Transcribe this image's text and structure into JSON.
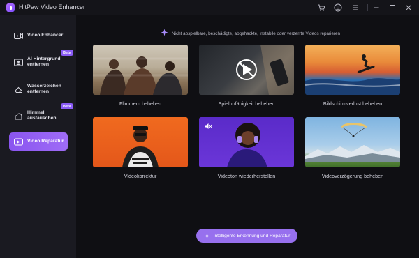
{
  "app": {
    "title": "HitPaw Video Enhancer"
  },
  "sidebar": {
    "items": [
      {
        "label": "Video Enhancer",
        "icon": "video-enhance-icon",
        "active": false,
        "beta": false
      },
      {
        "label": "AI Hintergrund entfernen",
        "icon": "background-remove-icon",
        "active": false,
        "beta": true
      },
      {
        "label": "Wasserzeichen entfernen",
        "icon": "eraser-icon",
        "active": false,
        "beta": false
      },
      {
        "label": "Himmel austauschen",
        "icon": "sky-icon",
        "active": false,
        "beta": true
      },
      {
        "label": "Video Reparatur",
        "icon": "video-repair-icon",
        "active": true,
        "beta": false
      }
    ],
    "beta_label": "Beta"
  },
  "main": {
    "hint": "Nicht abspielbare, beschädigte, abgehackte, instabile oder verzerrte Videos reparieren",
    "cards": [
      {
        "label": "Flimmern beheben"
      },
      {
        "label": "Spielunfähigkeit beheben"
      },
      {
        "label": "Bildschirmverlust beheben"
      },
      {
        "label": "Videokorrektur"
      },
      {
        "label": "Videoton wiederherstellen"
      },
      {
        "label": "Videoverzögerung beheben"
      }
    ],
    "cta_label": "Intelligente Erkennung und Reparatur"
  },
  "colors": {
    "accent": "#8b5cf6",
    "sidebar_bg": "#1a1a21",
    "main_bg": "#0f0f13"
  }
}
